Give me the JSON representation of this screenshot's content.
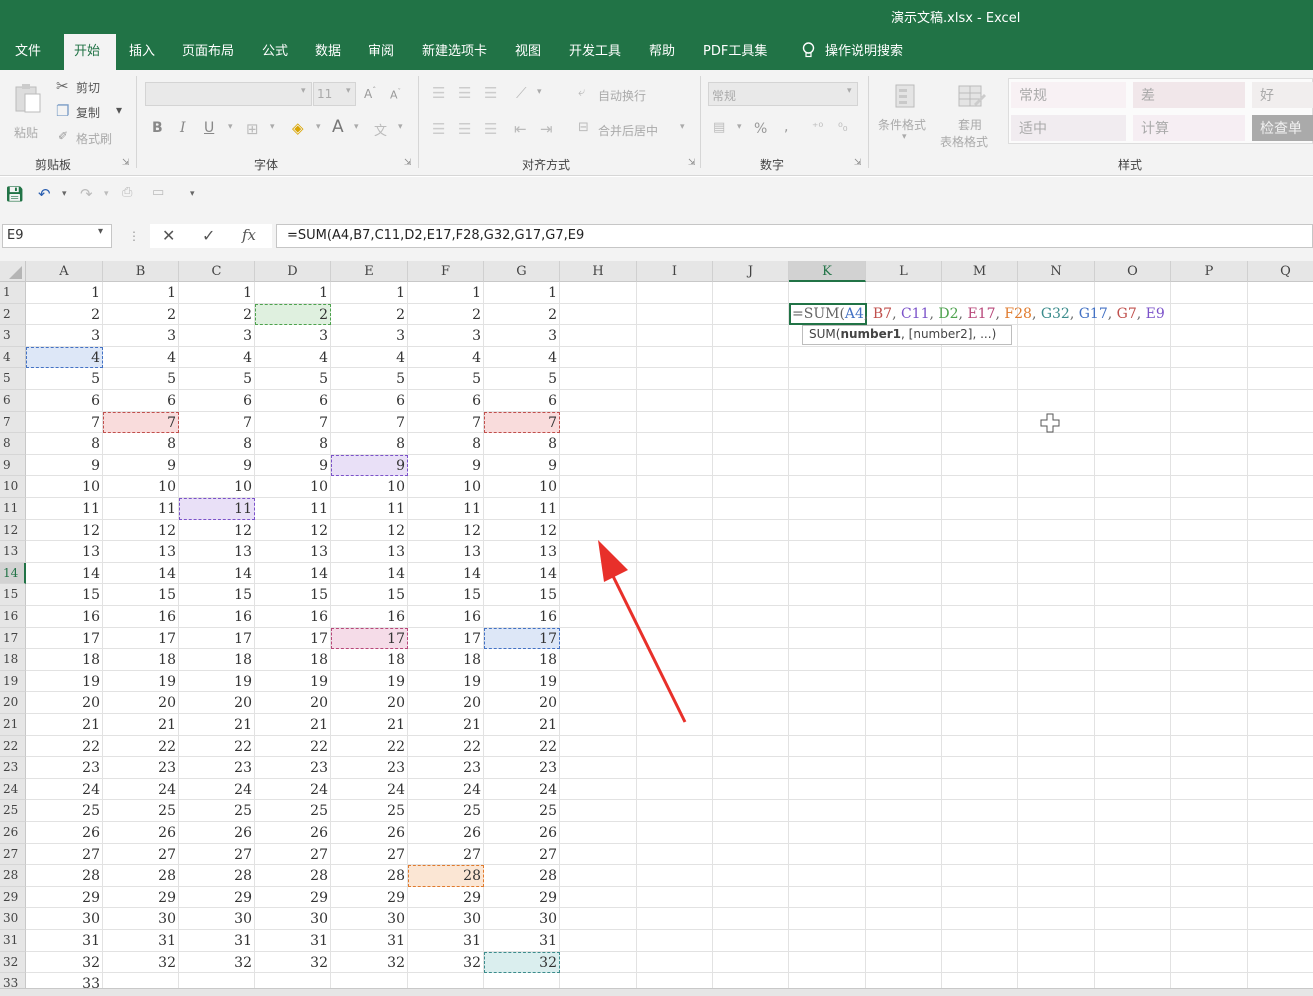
{
  "window": {
    "title": "演示文稿.xlsx",
    "app": "Excel"
  },
  "tabs": [
    "文件",
    "开始",
    "插入",
    "页面布局",
    "公式",
    "数据",
    "审阅",
    "新建选项卡",
    "视图",
    "开发工具",
    "帮助",
    "PDF工具集"
  ],
  "active_tab": "开始",
  "tell_me": "操作说明搜索",
  "ribbon": {
    "clipboard": {
      "paste": "粘贴",
      "cut": "剪切",
      "copy": "复制",
      "format_painter": "格式刷",
      "label": "剪贴板"
    },
    "font": {
      "size": "11",
      "bold": "B",
      "italic": "I",
      "underline": "U",
      "label": "字体",
      "font_color_letter": "A"
    },
    "alignment": {
      "wrap": "自动换行",
      "merge": "合并后居中",
      "label": "对齐方式"
    },
    "number": {
      "format": "常规",
      "percent": "%",
      "comma": ",",
      "label": "数字"
    },
    "styles": {
      "conditional": "条件格式",
      "table_line1": "套用",
      "table_line2": "表格格式",
      "cells": [
        "常规",
        "差",
        "好",
        "适中",
        "计算",
        "检查单"
      ],
      "label": "样式"
    }
  },
  "formula_bar": {
    "name_box": "E9",
    "cancel": "✕",
    "enter": "✓",
    "fx": "fx",
    "formula": "=SUM(A4,B7,C11,D2,E17,F28,G32,G17,G7,E9"
  },
  "grid": {
    "columns": [
      "A",
      "B",
      "C",
      "D",
      "E",
      "F",
      "G",
      "H",
      "I",
      "J",
      "K",
      "L",
      "M",
      "N",
      "O",
      "P",
      "Q"
    ],
    "selected_column": "K",
    "selected_row": 14,
    "rows": [
      1,
      2,
      3,
      4,
      5,
      6,
      7,
      8,
      9,
      10,
      11,
      12,
      13,
      14,
      15,
      16,
      17,
      18,
      19,
      20,
      21,
      22,
      23,
      24,
      25,
      26,
      27,
      28,
      29,
      30,
      31,
      32,
      33
    ],
    "data_columns": [
      "A",
      "B",
      "C",
      "D",
      "E",
      "F",
      "G"
    ],
    "values_per_row": "row number in A..G for rows 1-32, A33 = 33",
    "references": [
      {
        "cell": "A4",
        "color": "#4472c4",
        "fill": "#dde7f7"
      },
      {
        "cell": "B7",
        "color": "#c0504d",
        "fill": "#f9dcdc"
      },
      {
        "cell": "C11",
        "color": "#7b52c9",
        "fill": "#e9e0f7"
      },
      {
        "cell": "D2",
        "color": "#4ea24e",
        "fill": "#dff0df"
      },
      {
        "cell": "E17",
        "color": "#b8487a",
        "fill": "#f5dce8"
      },
      {
        "cell": "F28",
        "color": "#e07b2e",
        "fill": "#fbe6d4"
      },
      {
        "cell": "G32",
        "color": "#3c8c8c",
        "fill": "#daeeee"
      },
      {
        "cell": "G17",
        "color": "#4472c4",
        "fill": "#dde7f7"
      },
      {
        "cell": "G7",
        "color": "#c0504d",
        "fill": "#f9dcdc"
      },
      {
        "cell": "E9",
        "color": "#7b52c9",
        "fill": "#e9e0f7"
      }
    ]
  },
  "edit_cell": {
    "cell": "K14",
    "prefix": "=SUM(",
    "args": [
      {
        "text": "A4",
        "color": "#4472c4"
      },
      {
        "text": "B7",
        "color": "#c0504d"
      },
      {
        "text": "C11",
        "color": "#7b52c9"
      },
      {
        "text": "D2",
        "color": "#4ea24e"
      },
      {
        "text": "E17",
        "color": "#b8487a"
      },
      {
        "text": "F28",
        "color": "#e07b2e"
      },
      {
        "text": "G32",
        "color": "#3c8c8c"
      },
      {
        "text": "G17",
        "color": "#4472c4"
      },
      {
        "text": "G7",
        "color": "#c0504d"
      },
      {
        "text": "E9",
        "color": "#7b52c9"
      }
    ],
    "tooltip_fn": "SUM(",
    "tooltip_bold": "number1",
    "tooltip_rest": ", [number2], ...)"
  },
  "colors": {
    "brand": "#217346",
    "annotation_arrow": "#e8302a"
  }
}
